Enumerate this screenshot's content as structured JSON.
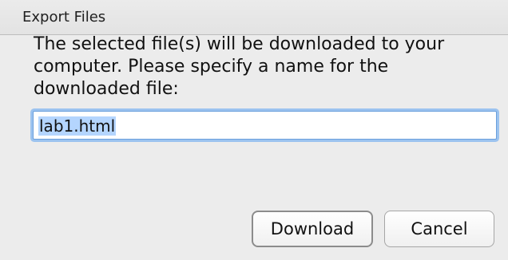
{
  "dialog": {
    "title": "Export Files",
    "message_lines": [
      "The selected file(s) will be downloaded to your",
      "computer. Please specify a name for the",
      "downloaded file:"
    ],
    "filename_value": "lab1.html",
    "buttons": {
      "download_label": "Download",
      "cancel_label": "Cancel"
    }
  }
}
